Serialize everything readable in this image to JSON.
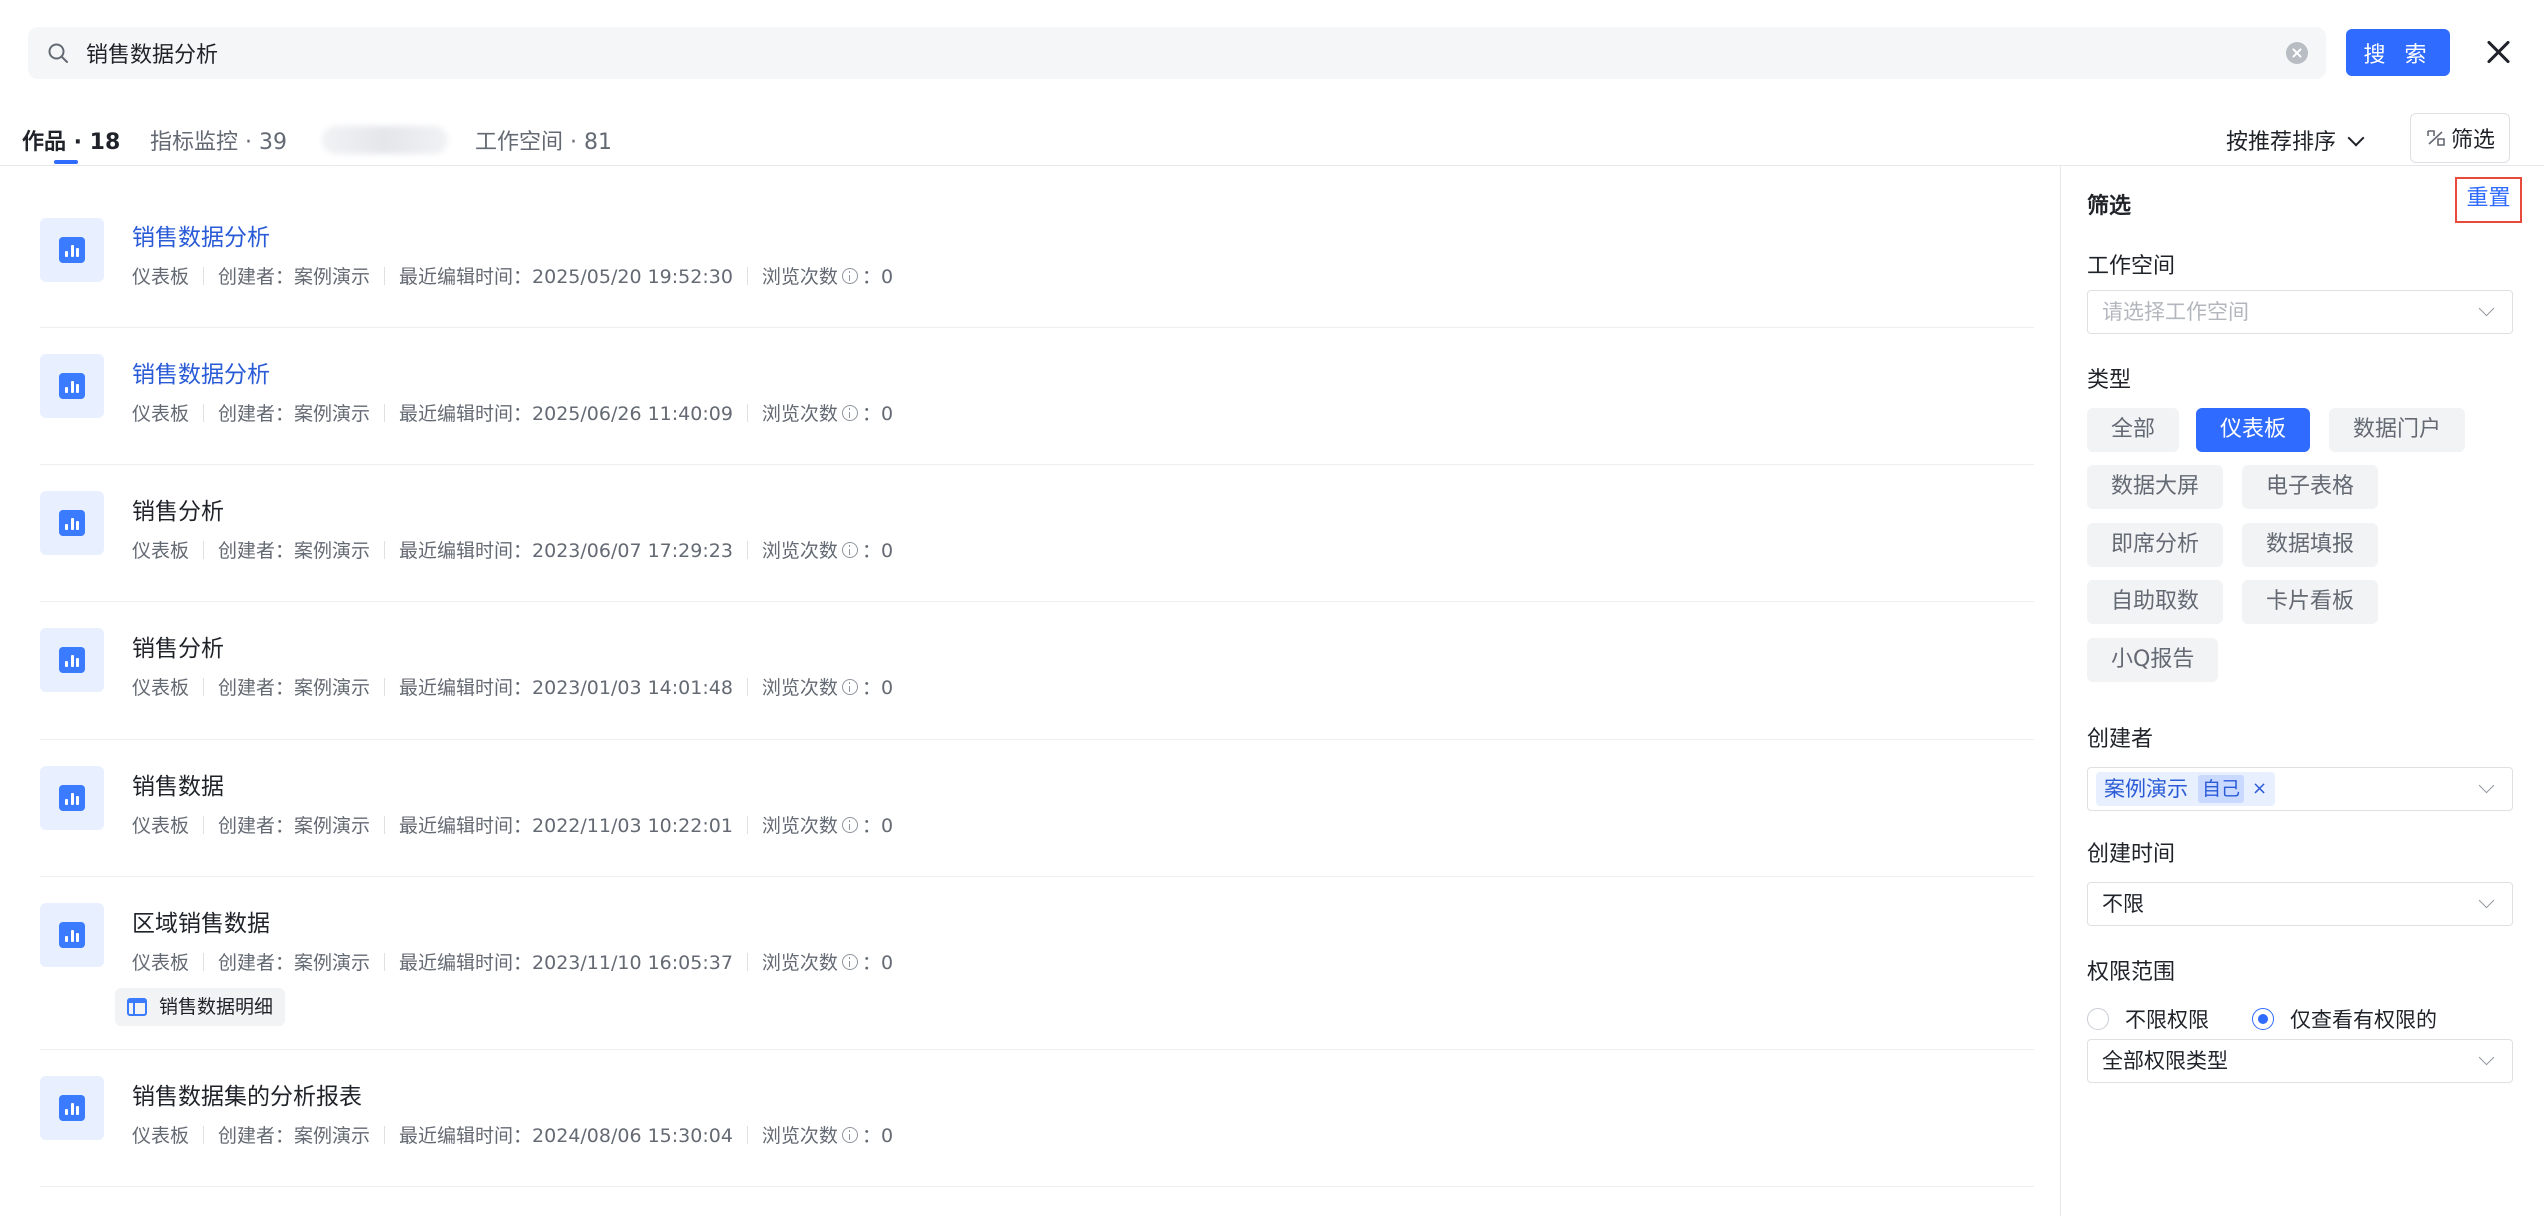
{
  "search": {
    "value": "销售数据分析",
    "button_label": "搜 索"
  },
  "tabs": [
    {
      "label": "作品 · 18",
      "active": true
    },
    {
      "label": "指标监控 · 39",
      "active": false
    },
    {
      "label": "工作空间 · 81",
      "active": false
    }
  ],
  "toolbar": {
    "sort_label": "按推荐排序",
    "filter_label": "筛选"
  },
  "results": [
    {
      "title": "销售数据分析",
      "highlight": true,
      "type": "仪表板",
      "creator": "创建者：案例演示",
      "edited": "最近编辑时间：2025/05/20 19:52:30",
      "views_label": "浏览次数",
      "views": "：0"
    },
    {
      "title": "销售数据分析",
      "highlight": true,
      "type": "仪表板",
      "creator": "创建者：案例演示",
      "edited": "最近编辑时间：2025/06/26 11:40:09",
      "views_label": "浏览次数",
      "views": "：0"
    },
    {
      "title": "销售分析",
      "highlight": false,
      "type": "仪表板",
      "creator": "创建者：案例演示",
      "edited": "最近编辑时间：2023/06/07 17:29:23",
      "views_label": "浏览次数",
      "views": "：0"
    },
    {
      "title": "销售分析",
      "highlight": false,
      "type": "仪表板",
      "creator": "创建者：案例演示",
      "edited": "最近编辑时间：2023/01/03 14:01:48",
      "views_label": "浏览次数",
      "views": "：0"
    },
    {
      "title": "销售数据",
      "highlight": false,
      "type": "仪表板",
      "creator": "创建者：案例演示",
      "edited": "最近编辑时间：2022/11/03 10:22:01",
      "views_label": "浏览次数",
      "views": "：0"
    },
    {
      "title": "区域销售数据",
      "highlight": false,
      "type": "仪表板",
      "creator": "创建者：案例演示",
      "edited": "最近编辑时间：2023/11/10 16:05:37",
      "views_label": "浏览次数",
      "views": "：0",
      "related": "销售数据明细"
    },
    {
      "title": "销售数据集的分析报表",
      "highlight": false,
      "type": "仪表板",
      "creator": "创建者：案例演示",
      "edited": "最近编辑时间：2024/08/06 15:30:04",
      "views_label": "浏览次数",
      "views": "：0"
    }
  ],
  "filter_panel": {
    "title": "筛选",
    "reset_label": "重置",
    "workspace": {
      "label": "工作空间",
      "placeholder": "请选择工作空间"
    },
    "type": {
      "label": "类型",
      "options": [
        "全部",
        "仪表板",
        "数据门户",
        "数据大屏",
        "电子表格",
        "即席分析",
        "数据填报",
        "自助取数",
        "卡片看板",
        "小Q报告"
      ],
      "selected": "仪表板"
    },
    "creator": {
      "label": "创建者",
      "tag": "案例演示",
      "self_badge": "自己"
    },
    "created_time": {
      "label": "创建时间",
      "value": "不限"
    },
    "permission": {
      "label": "权限范围",
      "option_unlimited": "不限权限",
      "option_own": "仅查看有权限的",
      "selected": "option_own",
      "type_value": "全部权限类型"
    }
  },
  "colors": {
    "accent": "#2f6bff",
    "highlight_title": "#2a5bd7",
    "reset_outline": "#e84a3c"
  }
}
